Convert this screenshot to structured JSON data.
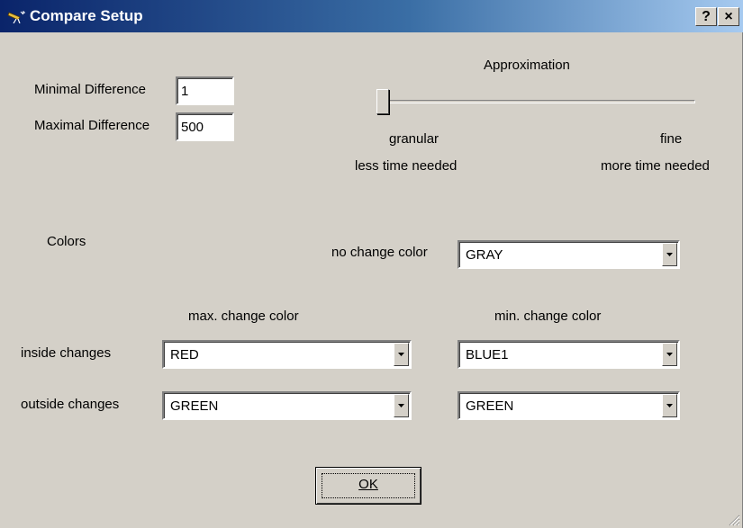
{
  "window": {
    "title": "Compare Setup",
    "help_label": "?",
    "close_label": "×"
  },
  "difference": {
    "min_label": "Minimal Difference",
    "min_value": "1",
    "max_label": "Maximal Difference",
    "max_value": "500"
  },
  "approximation": {
    "label": "Approximation",
    "left_label": "granular",
    "left_sub": "less time needed",
    "right_label": "fine",
    "right_sub": "more time needed",
    "position": 0
  },
  "colors": {
    "section_label": "Colors",
    "no_change_label": "no change color",
    "no_change_value": "GRAY",
    "max_header": "max. change color",
    "min_header": "min. change color",
    "inside_label": "inside changes",
    "outside_label": "outside changes",
    "inside_max": "RED",
    "inside_min": "BLUE1",
    "outside_max": "GREEN",
    "outside_min": "GREEN"
  },
  "ok_label": "OK",
  "icons": {
    "app": "telescope-icon",
    "help": "help-icon",
    "close": "close-icon",
    "dropdown": "chevron-down-icon",
    "resize": "resize-grip-icon"
  }
}
